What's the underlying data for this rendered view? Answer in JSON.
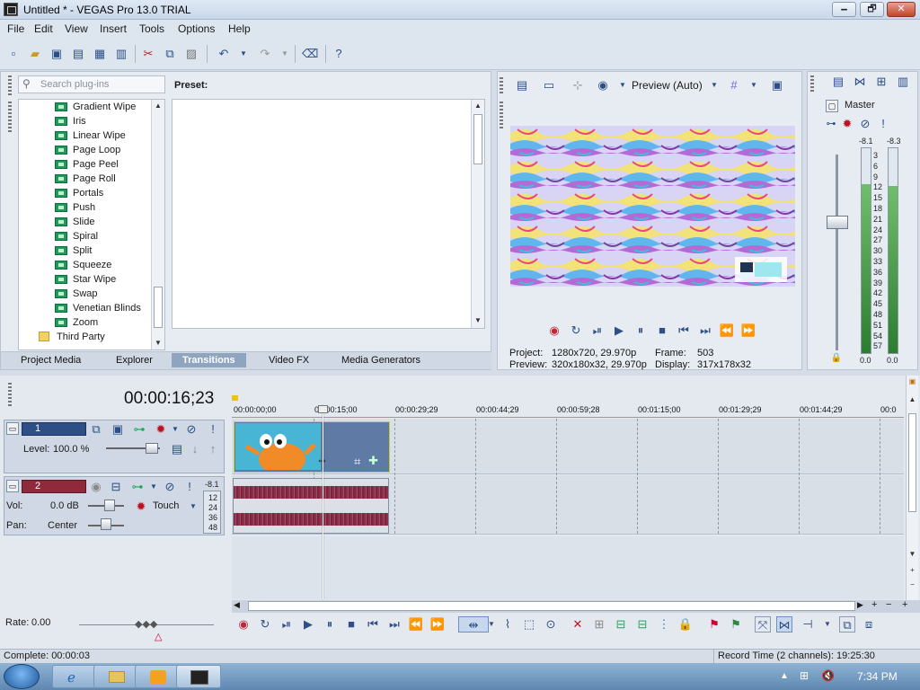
{
  "window": {
    "title": "Untitled * - VEGAS Pro 13.0 TRIAL",
    "min": "🗕",
    "max": "🗗",
    "close": "✕"
  },
  "menu": [
    "File",
    "Edit",
    "View",
    "Insert",
    "Tools",
    "Options",
    "Help"
  ],
  "toolbar_icons": [
    "new-icon",
    "open-icon",
    "save-icon",
    "save-as-icon",
    "render-icon",
    "properties-icon",
    "cut-icon",
    "copy-icon",
    "paste-icon",
    "undo-icon",
    "redo-icon",
    "erase-icon",
    "help-icon"
  ],
  "plugins": {
    "search_placeholder": "Search plug-ins",
    "preset_label": "Preset:",
    "items": [
      "Gradient Wipe",
      "Iris",
      "Linear Wipe",
      "Page Loop",
      "Page Peel",
      "Page Roll",
      "Portals",
      "Push",
      "Slide",
      "Spiral",
      "Split",
      "Squeeze",
      "Star Wipe",
      "Swap",
      "Venetian Blinds",
      "Zoom"
    ],
    "folder": "Third Party",
    "tabs": [
      "Project Media",
      "Explorer",
      "Transitions",
      "Video FX",
      "Media Generators"
    ],
    "active_tab": "Transitions"
  },
  "preview": {
    "mode": "Preview (Auto)",
    "project_label": "Project:",
    "project_value": "1280x720, 29.970p",
    "frame_label": "Frame:",
    "frame_value": "503",
    "preview_label": "Preview:",
    "preview_value": "320x180x32, 29.970p",
    "display_label": "Display:",
    "display_value": "317x178x32",
    "overlay_label": "⧉"
  },
  "master": {
    "label": "Master",
    "peak_left": "-8.1",
    "peak_right": "-8.3",
    "scale": [
      "3",
      "6",
      "9",
      "12",
      "15",
      "18",
      "21",
      "24",
      "27",
      "30",
      "33",
      "36",
      "39",
      "42",
      "45",
      "48",
      "51",
      "54",
      "57"
    ],
    "bottom_left": "0.0",
    "bottom_right": "0.0"
  },
  "timeline": {
    "timecode": "00:00:16;23",
    "ruler": [
      "00:00:00;00",
      "00:00:15;00",
      "00:00:29;29",
      "00:00:44;29",
      "00:00:59;28",
      "00:01:15;00",
      "00:01:29;29",
      "00:01:44;29",
      "00:0"
    ],
    "video_track": {
      "number": "1",
      "level_label": "Level:",
      "level_value": "100.0 %"
    },
    "audio_track": {
      "number": "2",
      "vol_label": "Vol:",
      "vol_value": "0.0 dB",
      "pan_label": "Pan:",
      "pan_value": "Center",
      "mode": "Touch",
      "peak": "-8.1",
      "meter_scale": [
        "12",
        "24",
        "36",
        "48"
      ]
    },
    "rate_label": "Rate:",
    "rate_value": "0.00"
  },
  "status": {
    "complete": "Complete: 00:00:03",
    "record_time": "Record Time (2 channels): 19:25:30"
  },
  "taskbar": {
    "clock": "7:34 PM"
  }
}
